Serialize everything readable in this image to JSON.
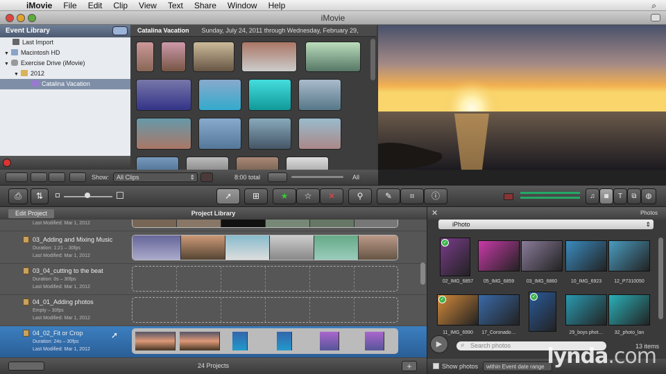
{
  "menubar": {
    "app": "iMovie",
    "items": [
      "File",
      "Edit",
      "Clip",
      "View",
      "Text",
      "Share",
      "Window",
      "Help"
    ]
  },
  "window": {
    "title": "iMovie"
  },
  "event_library": {
    "title": "Event Library",
    "items": [
      {
        "label": "Last Import",
        "indent": 1,
        "icon": "film-icon"
      },
      {
        "label": "Macintosh HD",
        "indent": 0,
        "icon": "computer-icon"
      },
      {
        "label": "Exercise Drive (iMovie)",
        "indent": 0,
        "icon": "drive-icon"
      },
      {
        "label": "2012",
        "indent": 1,
        "icon": "folder-icon"
      },
      {
        "label": "Catalina Vacation",
        "indent": 2,
        "icon": "star-icon",
        "selected": true
      }
    ]
  },
  "event_browser": {
    "title": "Catalina Vacation",
    "dates": "Sunday, July 24, 2011 through Wednesday, February 29,"
  },
  "controls": {
    "show_label": "Show:",
    "show_value": "All Clips",
    "total": "8:00 total",
    "all_label": "All"
  },
  "project": {
    "edit_label": "Edit Project",
    "library_label": "Project Library",
    "count": "24 Projects"
  },
  "projects": [
    {
      "name": "",
      "duration": "",
      "modified": "Last Modified: Mar 1, 2012",
      "kind": "partial"
    },
    {
      "name": "03_Adding and Mixing Music",
      "duration": "Duration: 1:21 – 30fps",
      "modified": "Last Modified: Mar 1, 2012",
      "kind": "music"
    },
    {
      "name": "03_04_cutting to the beat",
      "duration": "Duration: 0s – 30fps",
      "modified": "Last Modified: Mar 1, 2012",
      "kind": "empty"
    },
    {
      "name": "04_01_Adding photos",
      "duration": "Empty – 30fps",
      "modified": "Last Modified: Mar 1, 2012",
      "kind": "empty"
    },
    {
      "name": "04_02_Fit or Crop",
      "duration": "Duration: 24s – 30fps",
      "modified": "Last Modified: Mar 1, 2012",
      "kind": "crop",
      "selected": true
    }
  ],
  "photos": {
    "title": "Photos",
    "source": "iPhoto",
    "search_placeholder": "Search photos",
    "count": "13 items",
    "show_label": "Show photos",
    "range": "within Event date range",
    "items": [
      {
        "label": "02_IMG_6857",
        "color": "#7a3c8a",
        "checked": true
      },
      {
        "label": "05_IMG_6859",
        "color": "#c93aa8"
      },
      {
        "label": "03_IMG_6860",
        "color": "#8a7c9a"
      },
      {
        "label": "10_IMG_6923",
        "color": "#3a8cc0"
      },
      {
        "label": "12_P7310050",
        "color": "#4a9cc0"
      },
      {
        "label": "11_IMG_6990",
        "color": "#d48a3a",
        "checked": true
      },
      {
        "label": "17_Coronado…",
        "color": "#3a6aa8"
      },
      {
        "label": "",
        "color": "#2a5a9a",
        "checked": true
      },
      {
        "label": "29_boys phot…",
        "color": "#2a9ab0"
      },
      {
        "label": "32_photo_lan",
        "color": "#2ab0b8"
      }
    ]
  },
  "watermark": {
    "text": "lynda",
    "suffix": ".com"
  }
}
